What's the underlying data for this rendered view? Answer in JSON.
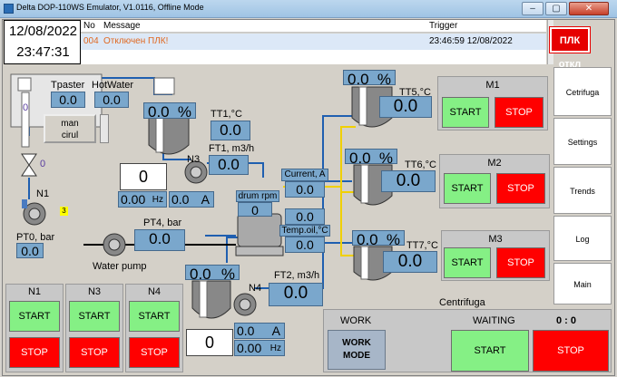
{
  "window": {
    "title": "Delta DOP-110WS Emulator, V1.0116, Offline Mode"
  },
  "clock": {
    "date": "12/08/2022",
    "time": "23:47:31"
  },
  "alarm": {
    "headers": {
      "no": "No",
      "message": "Message",
      "trigger": "Trigger"
    },
    "rows": [
      {
        "no": "004",
        "message": "Отключен ПЛК!",
        "trigger": "23:46:59 12/08/2022"
      }
    ]
  },
  "plc_button": {
    "label": "ПЛК откл"
  },
  "tank_left": {
    "level_label": "0",
    "level_value": "0",
    "n1_badge": "3",
    "tpaster_label": "Tpaster",
    "tpaster_value": "0.0",
    "hotwater_label": "HotWater",
    "hotwater_value": "0.0",
    "man_cirul_label": "man\ncirul"
  },
  "n1": {
    "label": "N1",
    "pt0_label": "PT0, bar",
    "pt0_value": "0.0"
  },
  "tank_mid": {
    "level_pct": "0.0",
    "pct_unit": "%"
  },
  "tt1": {
    "label": "TT1,°C",
    "value": "0.0"
  },
  "ft1": {
    "label": "FT1, m3/h",
    "value": "0.0"
  },
  "n3": {
    "label": "N3",
    "setpoint": "0",
    "hz_value": "0.00",
    "hz_unit": "Hz",
    "amp_value": "0.0",
    "amp_unit": "A"
  },
  "pt4": {
    "label": "PT4, bar",
    "value": "0.0"
  },
  "water_pump": {
    "label": "Water pump"
  },
  "centrifuga_mid": {
    "current_label": "Current, A",
    "current_value": "0.0",
    "drum_label": "drum rpm",
    "drum_value": "0",
    "second_value": "0.0",
    "temp_oil_label": "Temp.oil,°C",
    "temp_oil_value": "0.0"
  },
  "tank_bottom": {
    "level_pct": "0.0",
    "pct_unit": "%"
  },
  "n4": {
    "label": "N4",
    "setpoint": "0",
    "amp_value": "0.0",
    "amp_unit": "A",
    "hz_value": "0.00",
    "hz_unit": "Hz"
  },
  "ft2": {
    "label": "FT2, m3/h",
    "value": "0.0"
  },
  "tank5": {
    "level_pct": "0.0",
    "pct_unit": "%",
    "tt_label": "TT5,°C",
    "tt_value": "0.0"
  },
  "tank6": {
    "level_pct": "0.0",
    "pct_unit": "%",
    "tt_label": "TT6,°C",
    "tt_value": "0.0"
  },
  "tank7": {
    "level_pct": "0.0",
    "pct_unit": "%",
    "tt_label": "TT7,°C",
    "tt_value": "0.0"
  },
  "motors": [
    {
      "name": "M1",
      "start": "START",
      "stop": "STOP"
    },
    {
      "name": "M2",
      "start": "START",
      "stop": "STOP"
    },
    {
      "name": "M3",
      "start": "START",
      "stop": "STOP"
    }
  ],
  "sidenav": [
    "Cetrifuga",
    "Settings",
    "Trends",
    "Log",
    "Main"
  ],
  "pumps_bottom": [
    {
      "name": "N1",
      "start": "START",
      "stop": "STOP"
    },
    {
      "name": "N3",
      "start": "START",
      "stop": "STOP"
    },
    {
      "name": "N4",
      "start": "START",
      "stop": "STOP"
    }
  ],
  "centrifuga": {
    "title": "Centrifuga",
    "work_label": "WORK",
    "work_mode": "WORK\nMODE",
    "status": "WAITING",
    "counter": "0 : 0",
    "start": "START",
    "stop": "STOP"
  },
  "colors": {
    "field_bg": "#7aa7cc",
    "start_green": "#85f085",
    "stop_red": "#ff0000",
    "pipe_blue": "#1f5fb0",
    "pipe_yellow": "#f0d000"
  }
}
